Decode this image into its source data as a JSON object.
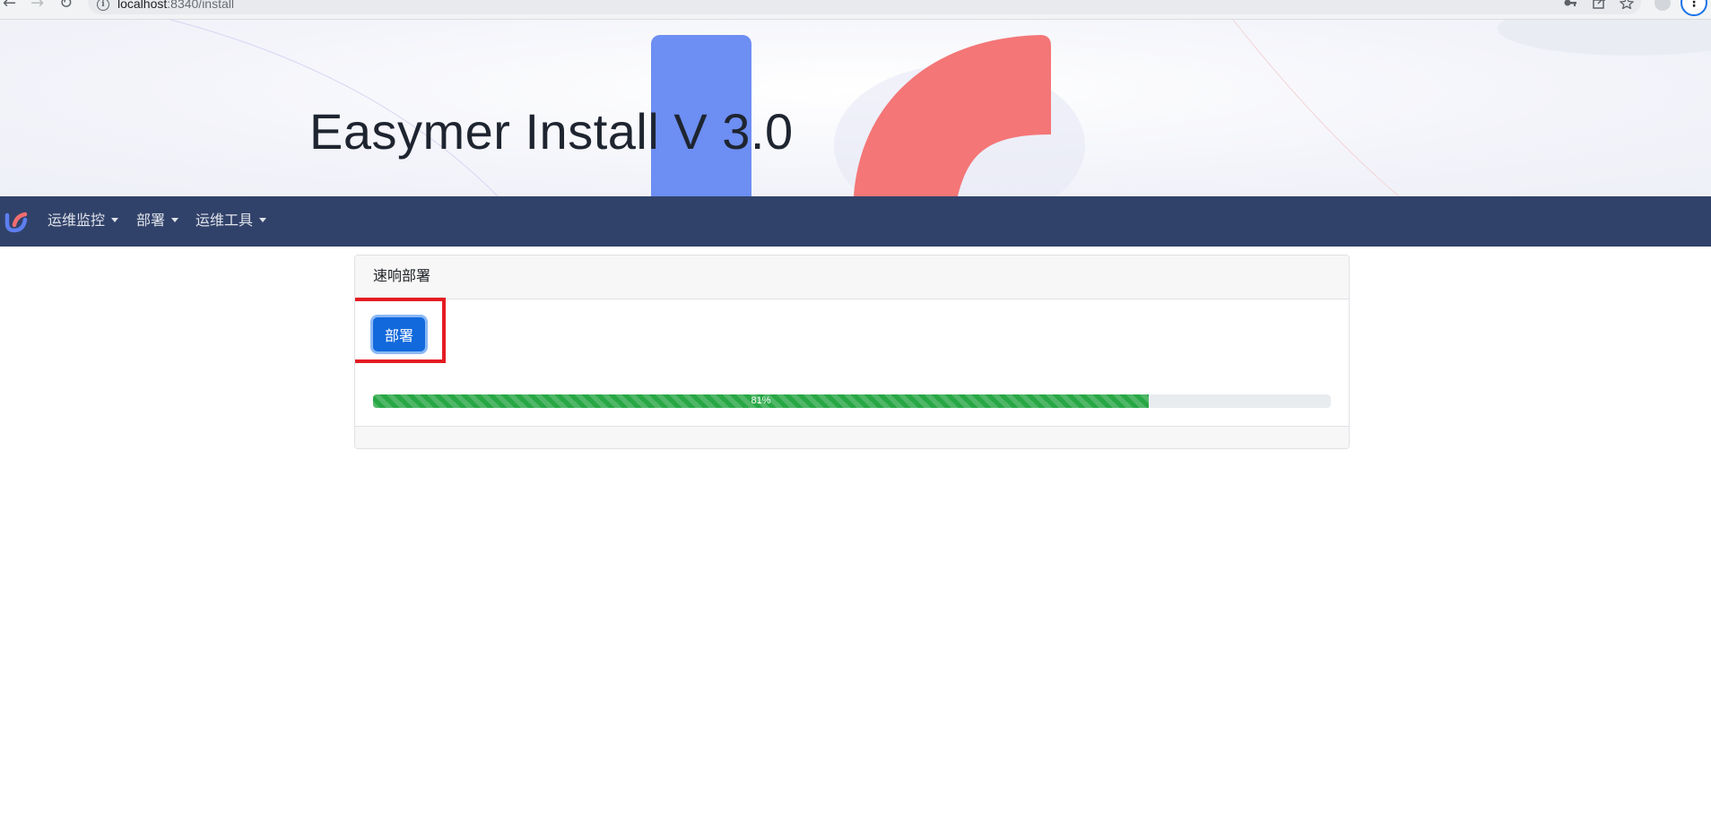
{
  "browser": {
    "url_host": "localhost",
    "url_path": ":8340/install",
    "nav": {
      "back": "←",
      "forward": "→",
      "reload": "↻"
    },
    "toolbar_icons": [
      "key-icon",
      "share-icon",
      "star-icon",
      "profile-icon",
      "menu-icon"
    ]
  },
  "banner": {
    "title": "Easymer Install V 3.0",
    "colors": {
      "blue_block": "#6d8ef2",
      "red_arc": "#f47677"
    }
  },
  "navbar": {
    "background": "#31426a",
    "items": [
      {
        "label": "运维监控"
      },
      {
        "label": "部署"
      },
      {
        "label": "运维工具"
      }
    ]
  },
  "card": {
    "title": "速响部署",
    "deploy_button": "部署",
    "progress": {
      "value": 0.81,
      "label": "81%",
      "color": "#28a745"
    }
  }
}
